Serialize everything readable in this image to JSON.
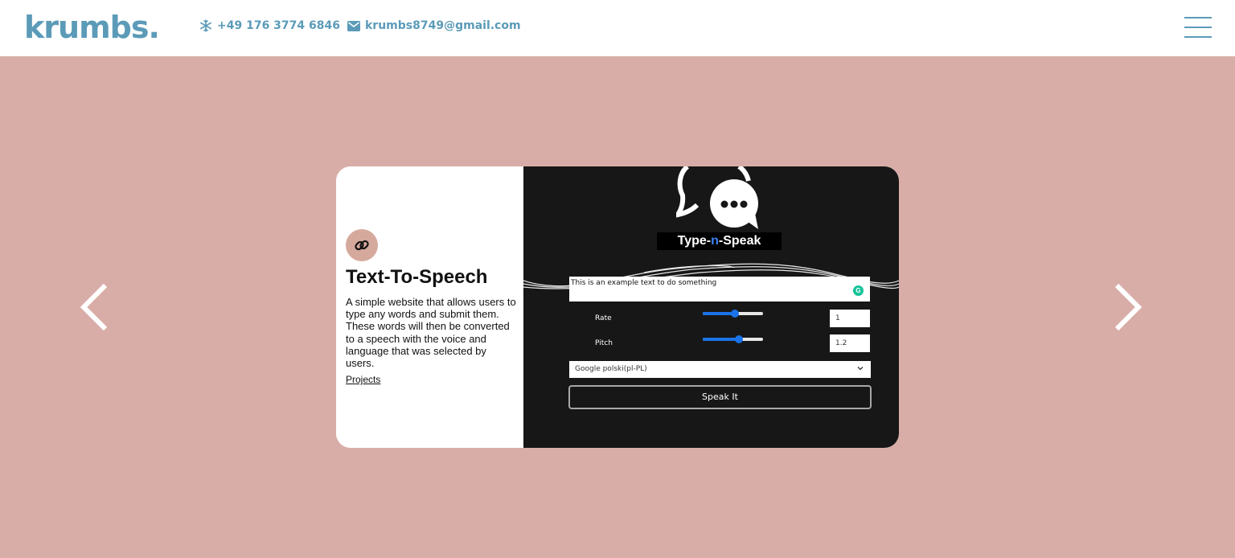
{
  "header": {
    "logo": "krumbs.",
    "phone": "+49 176 3774 6846",
    "email": "krumbs8749@gmail.com",
    "phone_icon": "snowflake-icon",
    "email_icon": "envelope-icon",
    "menu_icon": "hamburger-menu-icon"
  },
  "carousel": {
    "prev_icon": "chevron-left-icon",
    "next_icon": "chevron-right-icon"
  },
  "project": {
    "badge_icon": "link-icon",
    "title": "Text-To-Speech",
    "description": "A simple website that allows users to type any words and submit them. These words will then be converted to a speech with the voice and language that was selected by users.",
    "link_label": "Projects"
  },
  "preview": {
    "app_name_part1": "Type-",
    "app_name_part2": "n",
    "app_name_part3": "-Speak",
    "text_value": "This is an example text to do something",
    "grammarly_glyph": "G",
    "rate_label": "Rate",
    "rate_value": "1",
    "rate_fraction": 0.53,
    "pitch_label": "Pitch",
    "pitch_value": "1.2",
    "pitch_fraction": 0.6,
    "voice_selected": "Google polski(pl-PL)",
    "speak_label": "Speak It"
  },
  "colors": {
    "background": "#d9ada7",
    "brand": "#5b9bb8",
    "badge": "#d6a99d",
    "preview_bg": "#171717",
    "slider_accent": "#1a73e8"
  }
}
